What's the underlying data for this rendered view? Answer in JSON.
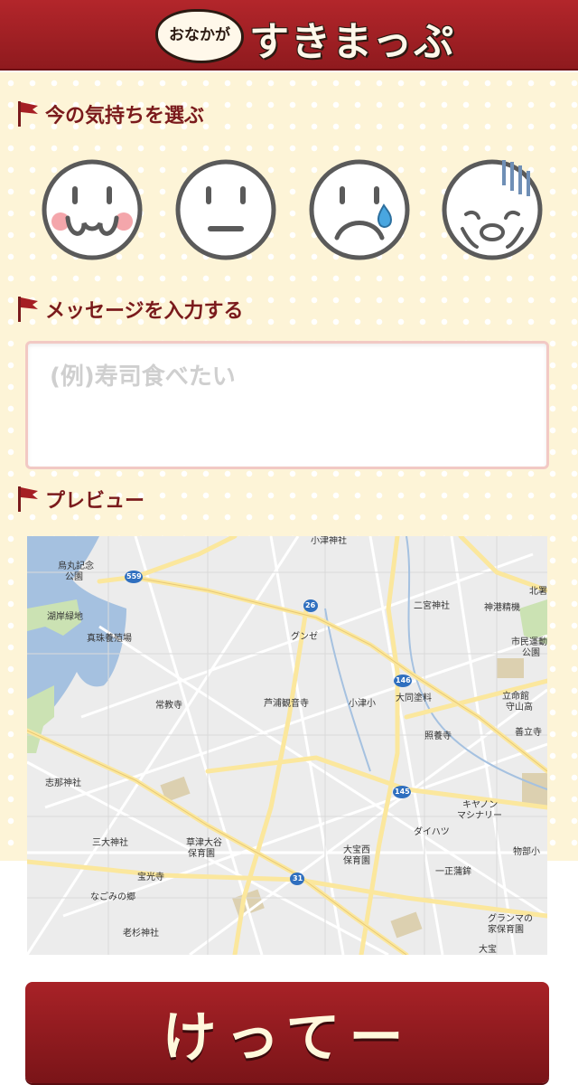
{
  "header": {
    "logo_small": "おなかが",
    "logo_big": "すきまっぷ"
  },
  "mood_section": {
    "title": "今の気持ちを選ぶ",
    "faces": [
      {
        "icon": "happy-face-icon"
      },
      {
        "icon": "neutral-face-icon"
      },
      {
        "icon": "crying-face-icon"
      },
      {
        "icon": "shocked-face-icon"
      }
    ]
  },
  "message_section": {
    "title": "メッセージを入力する",
    "input_value": "",
    "placeholder": "(例)寿司食べたい"
  },
  "preview_section": {
    "title": "プレビュー"
  },
  "map": {
    "labels": {
      "kotsu_shrine": "小津神社",
      "karasumaru": "烏丸記念",
      "park": "公園",
      "kogan": "湖岸緑地",
      "shinju": "真珠養殖場",
      "jokyo": "常教寺",
      "ashiura": "芦浦観音寺",
      "gunze": "グンゼ",
      "ninomiya": "二宮神社",
      "kamiminato": "神港精機",
      "kitajin": "北署",
      "shimin": "市民運動",
      "park2": "公園",
      "kotsu_elem": "小津小",
      "daido": "大同塗料",
      "ritsumei": "立命館",
      "moriyama": "守山高",
      "zenritsu": "善立寺",
      "shoyo": "照養寺",
      "shina": "志那神社",
      "yanmar": "キヤノン",
      "machinery": "マシナリー",
      "daihatsu": "ダイハツ",
      "monobe": "物部小",
      "sandai": "三大神社",
      "kusatsu": "草津大谷",
      "hoikuen": "保育園",
      "daiho": "大宝西",
      "hoikuen2": "保育園",
      "ichimasa": "一正蒲鉾",
      "hokoji": "宝光寺",
      "nagomi": "なごみの郷",
      "guranma": "グランマの",
      "ie": "家保育園",
      "oisugi": "老杉神社",
      "daiho2": "大宝",
      "route559": "559",
      "route26": "26",
      "route146": "146",
      "route145": "145",
      "route31": "31"
    }
  },
  "submit": {
    "label": "けってー"
  },
  "colors": {
    "header": "#9b1f23",
    "accent_text": "#7a1a1c",
    "background": "#fdf4d7",
    "button": "#8f1a1e",
    "face_outline": "#555555",
    "cheek": "#f4a6ab"
  }
}
